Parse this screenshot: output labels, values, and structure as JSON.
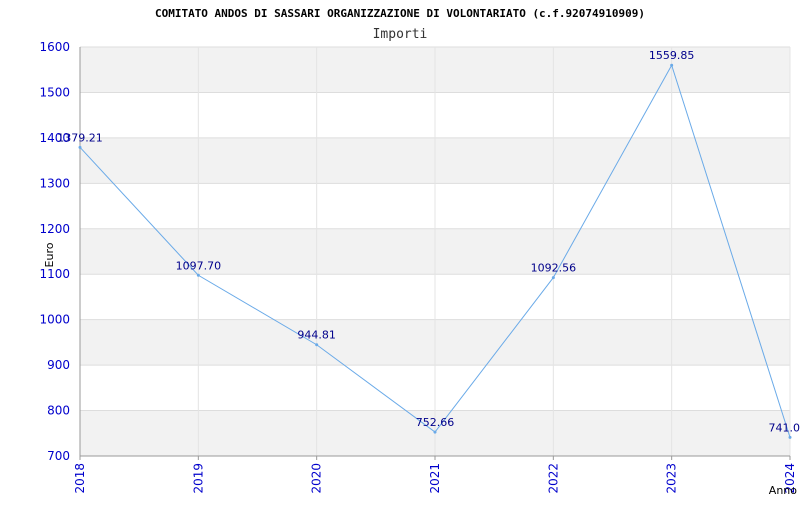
{
  "chart_data": {
    "type": "line",
    "title": "COMITATO ANDOS DI SASSARI ORGANIZZAZIONE DI VOLONTARIATO (c.f.92074910909)",
    "subtitle": "Importi",
    "xlabel": "Anno",
    "ylabel": "Euro",
    "x": [
      "2018",
      "2019",
      "2020",
      "2021",
      "2022",
      "2023",
      "2024"
    ],
    "series": [
      {
        "values": [
          1379.21,
          1097.7,
          944.81,
          752.66,
          1092.56,
          1559.85,
          741.0
        ],
        "labels": [
          "1379.21",
          "1097.70",
          "944.81",
          "752.66",
          "1092.56",
          "1559.85",
          "741.0"
        ]
      }
    ],
    "ylim": [
      700,
      1600
    ],
    "yticks": [
      "700",
      "800",
      "900",
      "1000",
      "1100",
      "1200",
      "1300",
      "1400",
      "1500",
      "1600"
    ],
    "grid": true,
    "colors": {
      "line": "#6aaae8",
      "band": "#f2f2f2",
      "tick_text": "#0000cc",
      "data_label": "#00008b"
    }
  }
}
